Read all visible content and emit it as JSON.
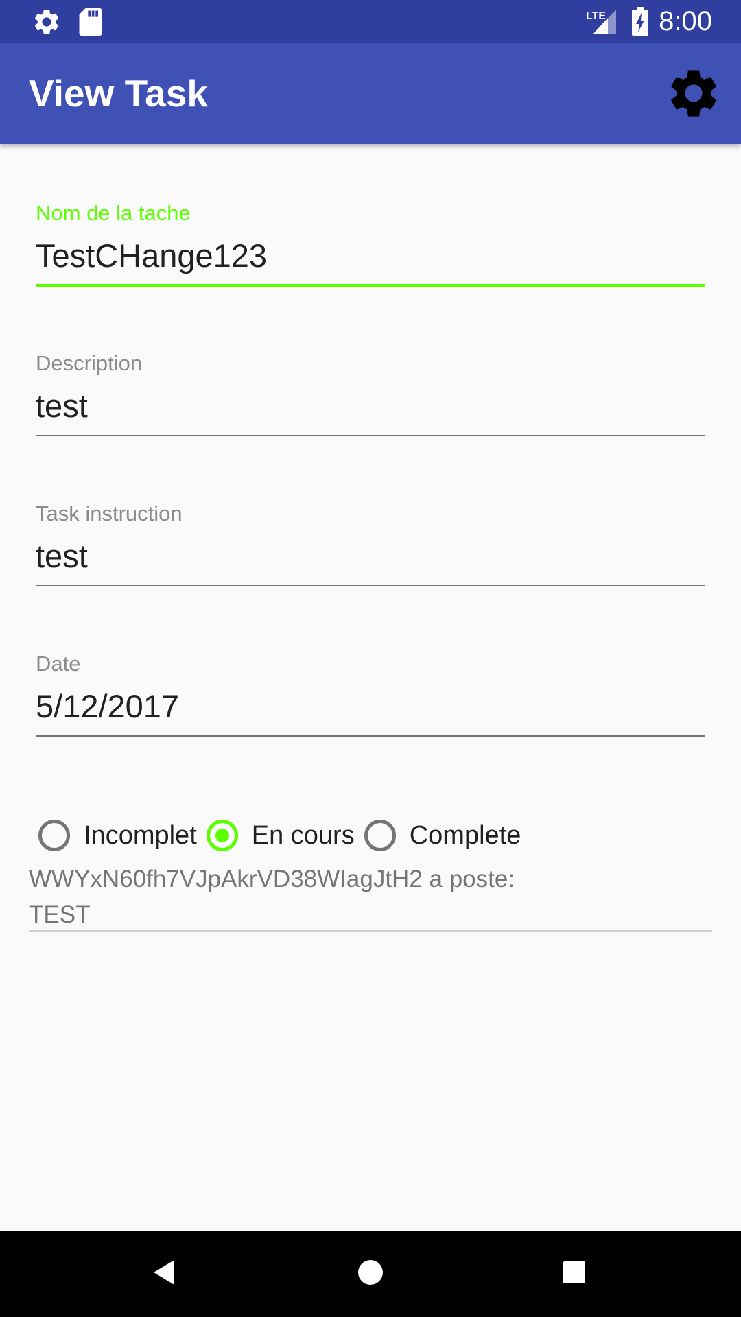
{
  "status_bar": {
    "time": "8:00",
    "network_label": "LTE",
    "left_icons": [
      "settings-icon",
      "sd-card-icon"
    ],
    "right_icons": [
      "signal-icon",
      "battery-charging-icon"
    ]
  },
  "app_bar": {
    "title": "View Task",
    "action_icon": "settings-gear-icon"
  },
  "form": {
    "task_name": {
      "label": "Nom de la tache",
      "value": "TestCHange123",
      "focused": true
    },
    "description": {
      "label": "Description",
      "value": "test"
    },
    "instruction": {
      "label": "Task instruction",
      "value": "test"
    },
    "date": {
      "label": "Date",
      "value": "5/12/2017"
    }
  },
  "status_options": [
    {
      "label": "Incomplet",
      "checked": false
    },
    {
      "label": "En cours",
      "checked": true
    },
    {
      "label": "Complete",
      "checked": false
    }
  ],
  "comment": {
    "line1": "WWYxN60fh7VJpAkrVD38WIagJtH2 a poste:",
    "line2": "TEST"
  },
  "nav_bar": {
    "buttons": [
      "back-icon",
      "home-icon",
      "recents-icon"
    ]
  },
  "colors": {
    "status_bar": "#303f9f",
    "app_bar": "#3f51b5",
    "accent": "#5cff00",
    "background": "#fafafa"
  }
}
